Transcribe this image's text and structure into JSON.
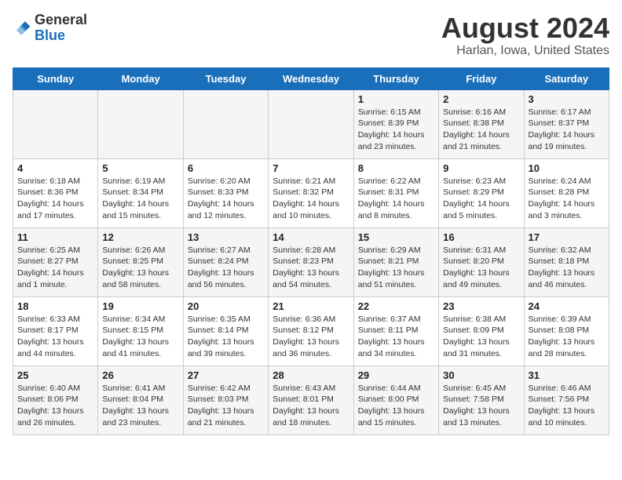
{
  "header": {
    "logo_line1": "General",
    "logo_line2": "Blue",
    "month_year": "August 2024",
    "location": "Harlan, Iowa, United States"
  },
  "weekdays": [
    "Sunday",
    "Monday",
    "Tuesday",
    "Wednesday",
    "Thursday",
    "Friday",
    "Saturday"
  ],
  "weeks": [
    [
      {
        "day": "",
        "info": ""
      },
      {
        "day": "",
        "info": ""
      },
      {
        "day": "",
        "info": ""
      },
      {
        "day": "",
        "info": ""
      },
      {
        "day": "1",
        "info": "Sunrise: 6:15 AM\nSunset: 8:39 PM\nDaylight: 14 hours\nand 23 minutes."
      },
      {
        "day": "2",
        "info": "Sunrise: 6:16 AM\nSunset: 8:38 PM\nDaylight: 14 hours\nand 21 minutes."
      },
      {
        "day": "3",
        "info": "Sunrise: 6:17 AM\nSunset: 8:37 PM\nDaylight: 14 hours\nand 19 minutes."
      }
    ],
    [
      {
        "day": "4",
        "info": "Sunrise: 6:18 AM\nSunset: 8:36 PM\nDaylight: 14 hours\nand 17 minutes."
      },
      {
        "day": "5",
        "info": "Sunrise: 6:19 AM\nSunset: 8:34 PM\nDaylight: 14 hours\nand 15 minutes."
      },
      {
        "day": "6",
        "info": "Sunrise: 6:20 AM\nSunset: 8:33 PM\nDaylight: 14 hours\nand 12 minutes."
      },
      {
        "day": "7",
        "info": "Sunrise: 6:21 AM\nSunset: 8:32 PM\nDaylight: 14 hours\nand 10 minutes."
      },
      {
        "day": "8",
        "info": "Sunrise: 6:22 AM\nSunset: 8:31 PM\nDaylight: 14 hours\nand 8 minutes."
      },
      {
        "day": "9",
        "info": "Sunrise: 6:23 AM\nSunset: 8:29 PM\nDaylight: 14 hours\nand 5 minutes."
      },
      {
        "day": "10",
        "info": "Sunrise: 6:24 AM\nSunset: 8:28 PM\nDaylight: 14 hours\nand 3 minutes."
      }
    ],
    [
      {
        "day": "11",
        "info": "Sunrise: 6:25 AM\nSunset: 8:27 PM\nDaylight: 14 hours\nand 1 minute."
      },
      {
        "day": "12",
        "info": "Sunrise: 6:26 AM\nSunset: 8:25 PM\nDaylight: 13 hours\nand 58 minutes."
      },
      {
        "day": "13",
        "info": "Sunrise: 6:27 AM\nSunset: 8:24 PM\nDaylight: 13 hours\nand 56 minutes."
      },
      {
        "day": "14",
        "info": "Sunrise: 6:28 AM\nSunset: 8:23 PM\nDaylight: 13 hours\nand 54 minutes."
      },
      {
        "day": "15",
        "info": "Sunrise: 6:29 AM\nSunset: 8:21 PM\nDaylight: 13 hours\nand 51 minutes."
      },
      {
        "day": "16",
        "info": "Sunrise: 6:31 AM\nSunset: 8:20 PM\nDaylight: 13 hours\nand 49 minutes."
      },
      {
        "day": "17",
        "info": "Sunrise: 6:32 AM\nSunset: 8:18 PM\nDaylight: 13 hours\nand 46 minutes."
      }
    ],
    [
      {
        "day": "18",
        "info": "Sunrise: 6:33 AM\nSunset: 8:17 PM\nDaylight: 13 hours\nand 44 minutes."
      },
      {
        "day": "19",
        "info": "Sunrise: 6:34 AM\nSunset: 8:15 PM\nDaylight: 13 hours\nand 41 minutes."
      },
      {
        "day": "20",
        "info": "Sunrise: 6:35 AM\nSunset: 8:14 PM\nDaylight: 13 hours\nand 39 minutes."
      },
      {
        "day": "21",
        "info": "Sunrise: 6:36 AM\nSunset: 8:12 PM\nDaylight: 13 hours\nand 36 minutes."
      },
      {
        "day": "22",
        "info": "Sunrise: 6:37 AM\nSunset: 8:11 PM\nDaylight: 13 hours\nand 34 minutes."
      },
      {
        "day": "23",
        "info": "Sunrise: 6:38 AM\nSunset: 8:09 PM\nDaylight: 13 hours\nand 31 minutes."
      },
      {
        "day": "24",
        "info": "Sunrise: 6:39 AM\nSunset: 8:08 PM\nDaylight: 13 hours\nand 28 minutes."
      }
    ],
    [
      {
        "day": "25",
        "info": "Sunrise: 6:40 AM\nSunset: 8:06 PM\nDaylight: 13 hours\nand 26 minutes."
      },
      {
        "day": "26",
        "info": "Sunrise: 6:41 AM\nSunset: 8:04 PM\nDaylight: 13 hours\nand 23 minutes."
      },
      {
        "day": "27",
        "info": "Sunrise: 6:42 AM\nSunset: 8:03 PM\nDaylight: 13 hours\nand 21 minutes."
      },
      {
        "day": "28",
        "info": "Sunrise: 6:43 AM\nSunset: 8:01 PM\nDaylight: 13 hours\nand 18 minutes."
      },
      {
        "day": "29",
        "info": "Sunrise: 6:44 AM\nSunset: 8:00 PM\nDaylight: 13 hours\nand 15 minutes."
      },
      {
        "day": "30",
        "info": "Sunrise: 6:45 AM\nSunset: 7:58 PM\nDaylight: 13 hours\nand 13 minutes."
      },
      {
        "day": "31",
        "info": "Sunrise: 6:46 AM\nSunset: 7:56 PM\nDaylight: 13 hours\nand 10 minutes."
      }
    ]
  ]
}
